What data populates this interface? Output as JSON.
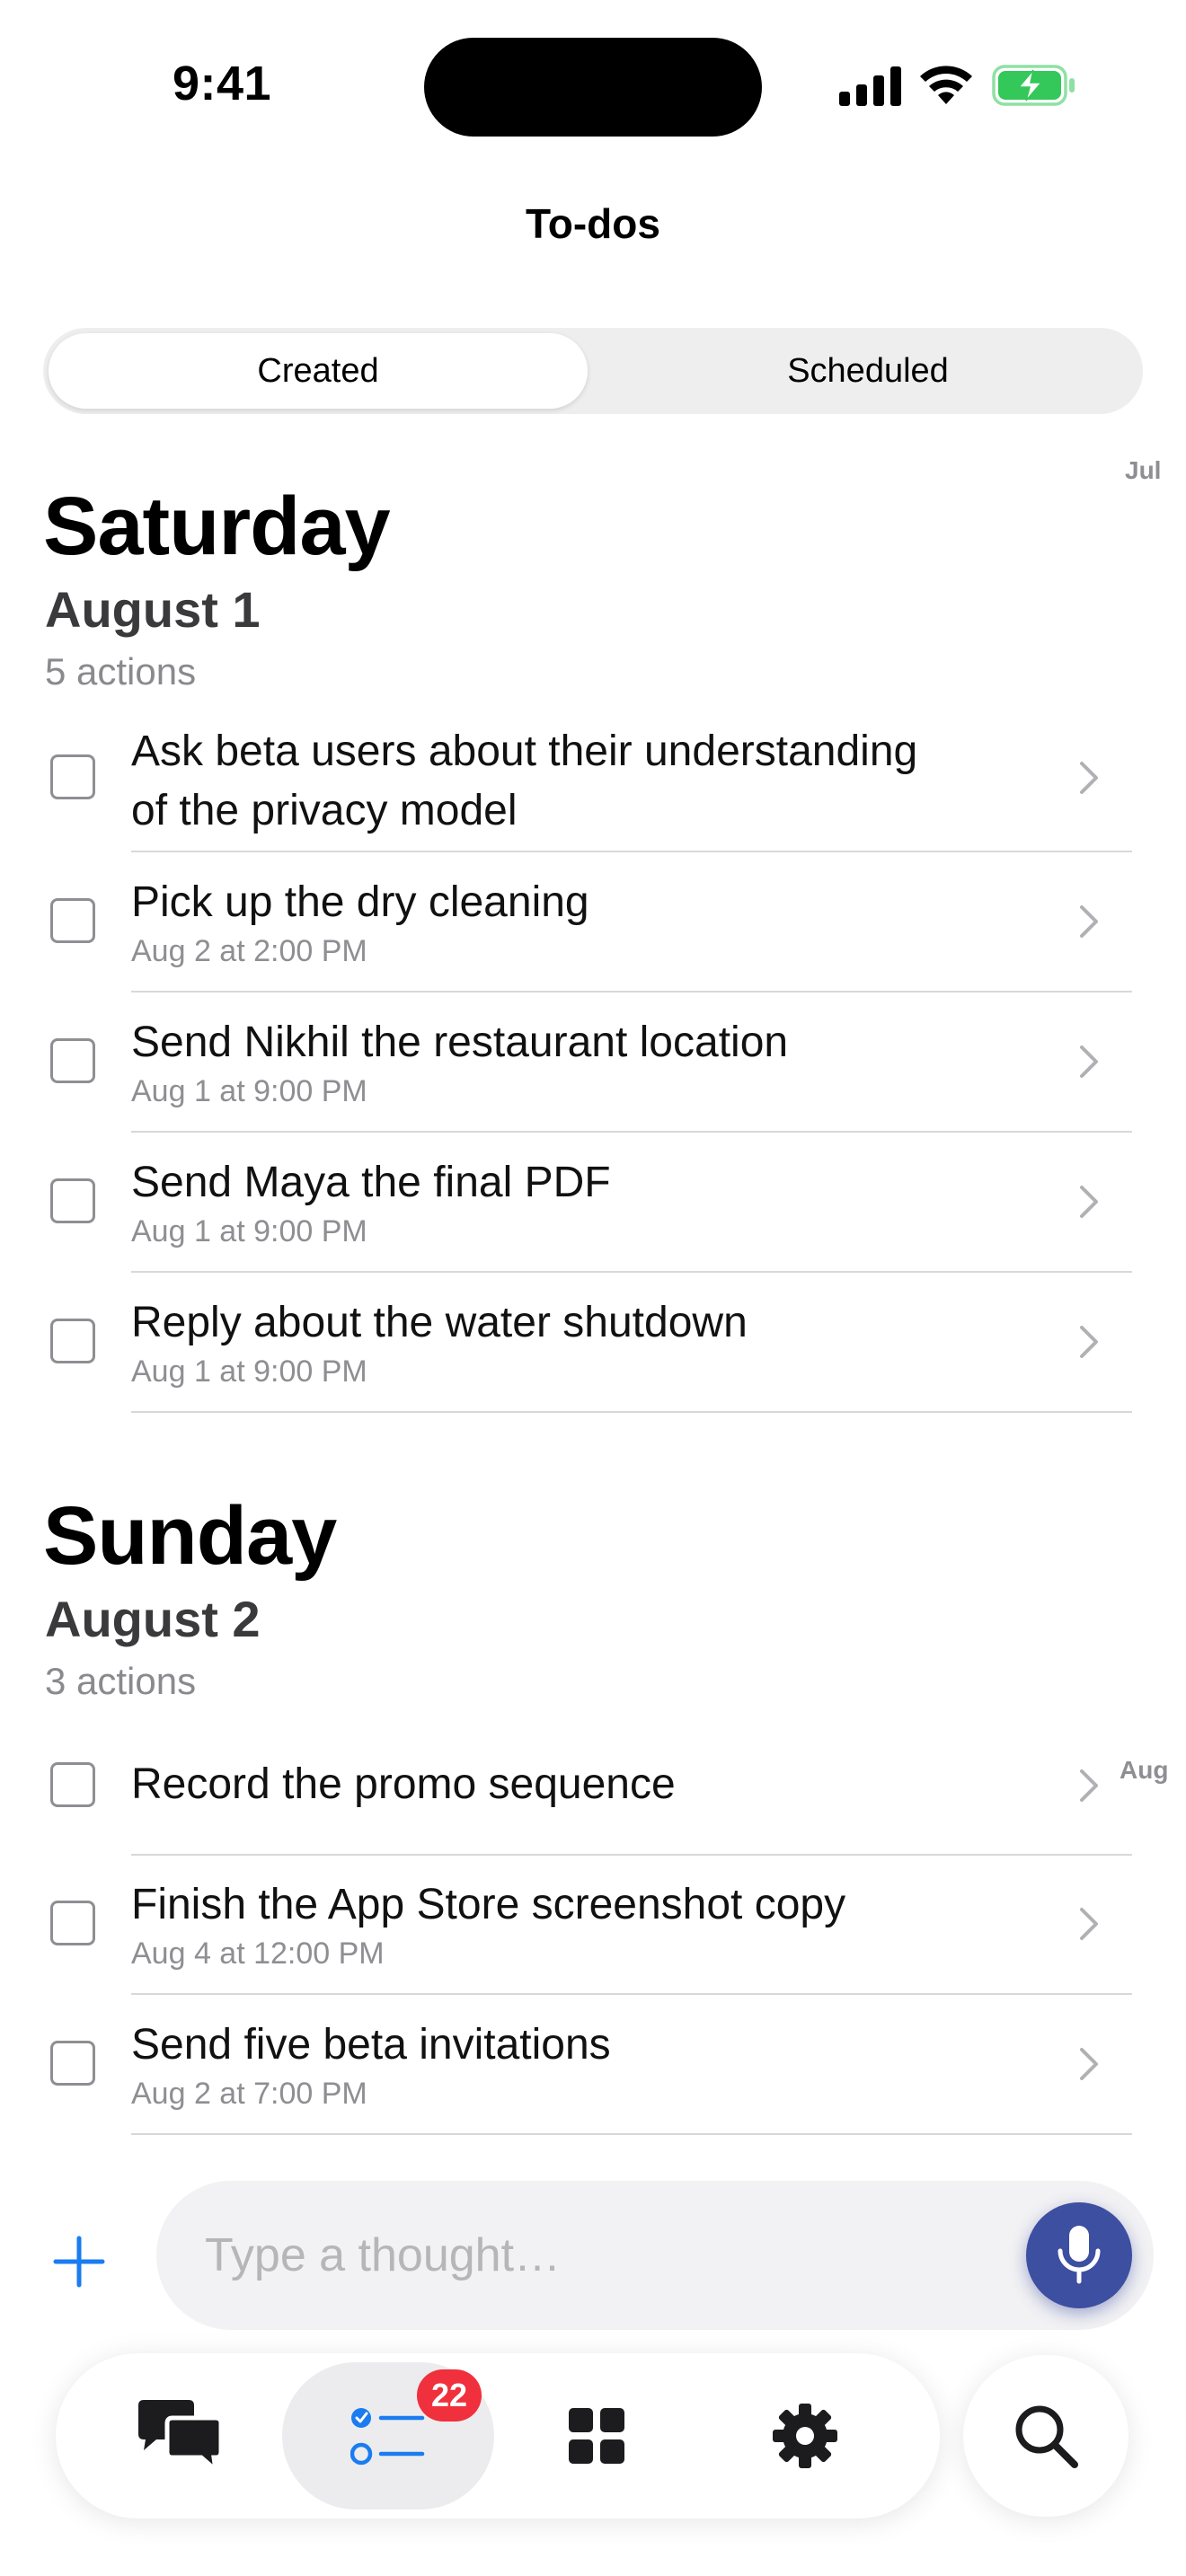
{
  "status_bar": {
    "time": "9:41",
    "battery_color": "#34c759"
  },
  "header": {
    "title": "To-dos"
  },
  "segments": {
    "created_label": "Created",
    "scheduled_label": "Scheduled",
    "selected": "Created"
  },
  "month_index": {
    "top": "Jul",
    "middle": "Aug"
  },
  "sections": [
    {
      "day": "Saturday",
      "date": "August 1",
      "count": "5 actions",
      "items": [
        {
          "title_line1": "Ask beta users about their understanding",
          "title_line2": "of the privacy model",
          "subtitle": ""
        },
        {
          "title": "Pick up the dry cleaning",
          "subtitle": "Aug 2 at 2:00 PM"
        },
        {
          "title": "Send Nikhil the restaurant location",
          "subtitle": "Aug 1 at 9:00 PM"
        },
        {
          "title": "Send Maya the final PDF",
          "subtitle": "Aug 1 at 9:00 PM"
        },
        {
          "title": "Reply about the water shutdown",
          "subtitle": "Aug 1 at 9:00 PM"
        }
      ]
    },
    {
      "day": "Sunday",
      "date": "August 2",
      "count": "3 actions",
      "items": [
        {
          "title": "Record the promo sequence",
          "subtitle": ""
        },
        {
          "title": "Finish the App Store screenshot copy",
          "subtitle": "Aug 4 at 12:00 PM"
        },
        {
          "title": "Send five beta invitations",
          "subtitle": "Aug 2 at 7:00 PM"
        }
      ]
    }
  ],
  "composer": {
    "placeholder": "Type a thought…",
    "accent": "#1a7cf0",
    "mic_color": "#3d4fa0"
  },
  "tab_bar": {
    "tabs": [
      {
        "icon": "chat-bubbles-icon"
      },
      {
        "icon": "checklist-icon",
        "badge": "22",
        "selected": true
      },
      {
        "icon": "grid-icon"
      },
      {
        "icon": "gear-icon"
      }
    ],
    "search_icon": "search-icon",
    "badge_color": "#f0303c"
  }
}
